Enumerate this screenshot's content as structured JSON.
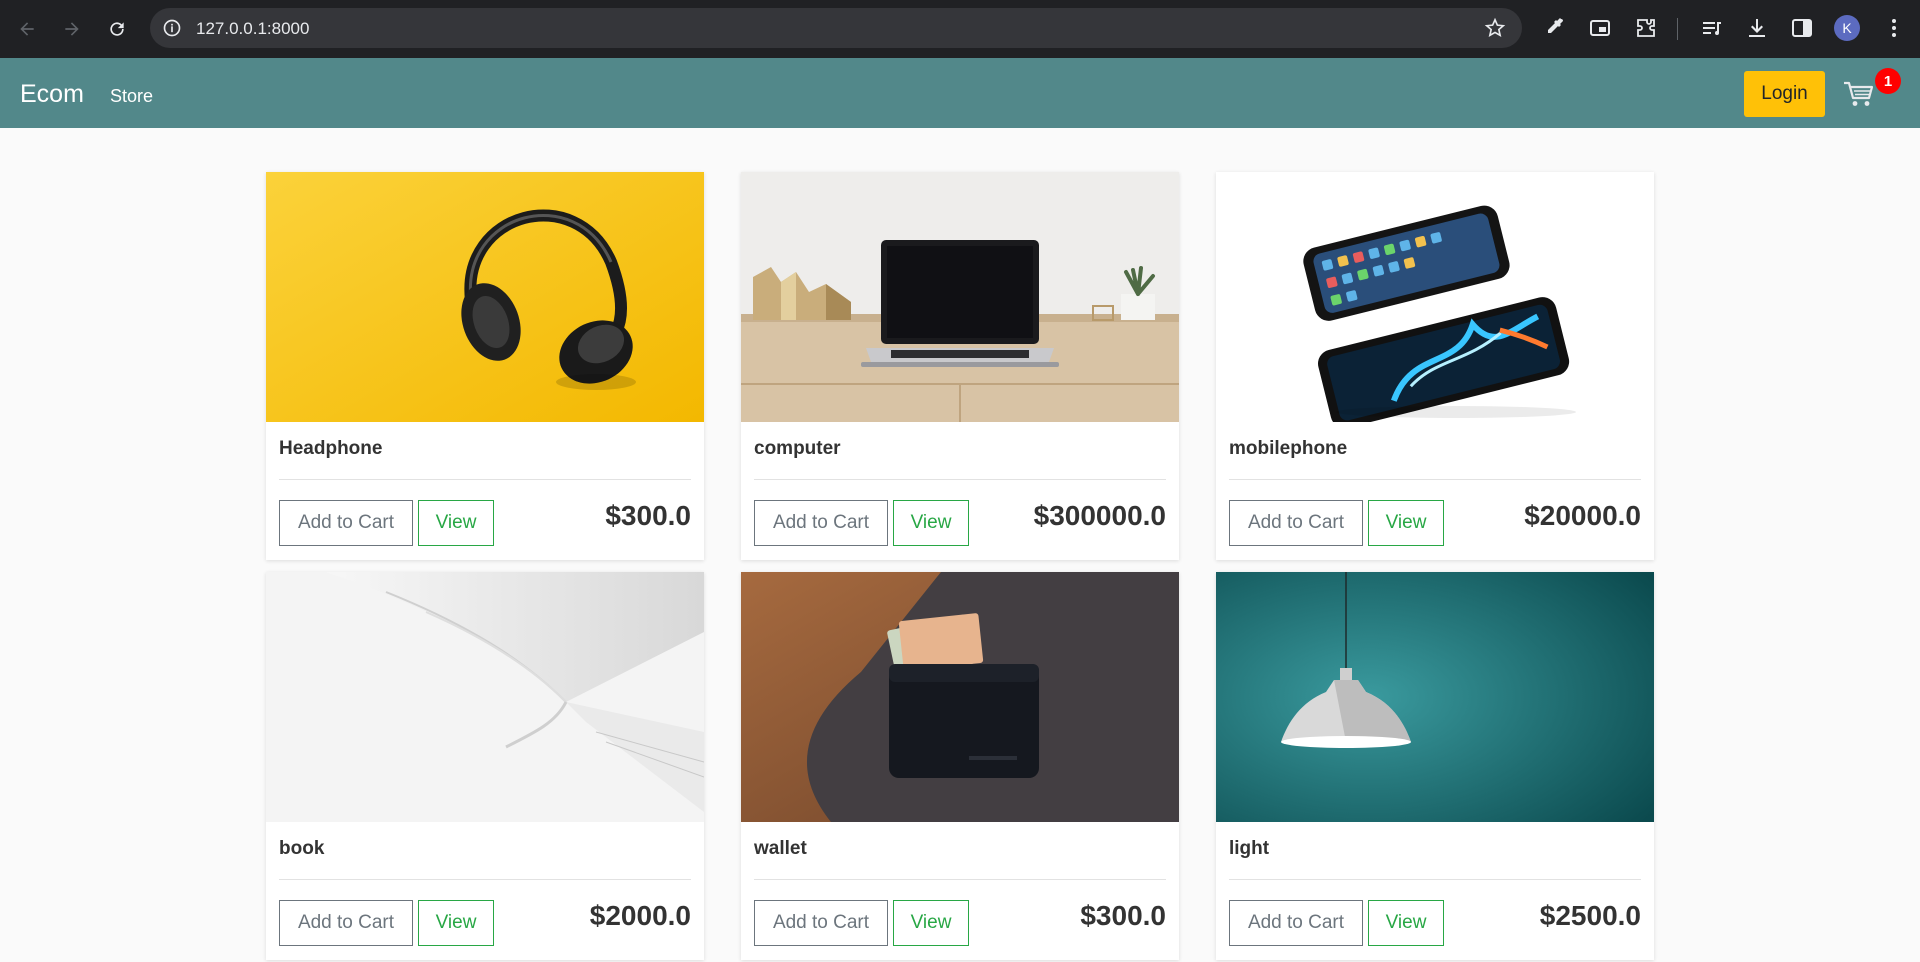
{
  "browser": {
    "url": "127.0.0.1:8000",
    "avatar_letter": "K"
  },
  "navbar": {
    "brand": "Ecom",
    "links": [
      "Store"
    ],
    "login_label": "Login",
    "cart_count": "1",
    "colors": {
      "navbar": "#52888a",
      "login": "#ffc107",
      "badge": "#ff0000"
    }
  },
  "products": [
    {
      "name": "Headphone",
      "price": "$300.0",
      "add_label": "Add to Cart",
      "view_label": "View",
      "image": "headphone-image"
    },
    {
      "name": "computer",
      "price": "$300000.0",
      "add_label": "Add to Cart",
      "view_label": "View",
      "image": "laptop-image"
    },
    {
      "name": "mobilephone",
      "price": "$20000.0",
      "add_label": "Add to Cart",
      "view_label": "View",
      "image": "smartphone-image"
    },
    {
      "name": "book",
      "price": "$2000.0",
      "add_label": "Add to Cart",
      "view_label": "View",
      "image": "book-image"
    },
    {
      "name": "wallet",
      "price": "$300.0",
      "add_label": "Add to Cart",
      "view_label": "View",
      "image": "wallet-image"
    },
    {
      "name": "light",
      "price": "$2500.0",
      "add_label": "Add to Cart",
      "view_label": "View",
      "image": "lamp-image"
    }
  ]
}
